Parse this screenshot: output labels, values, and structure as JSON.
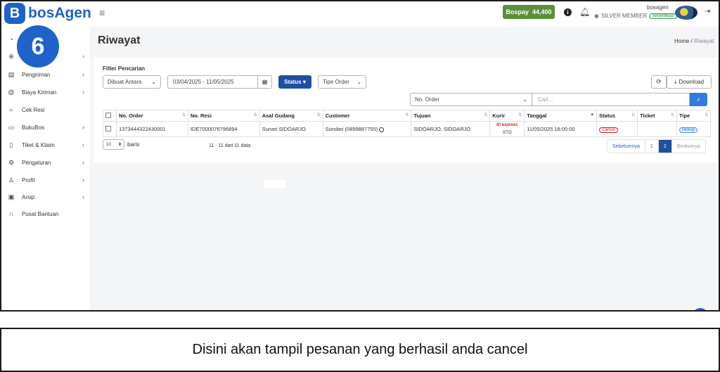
{
  "brand": {
    "logo_letter": "B",
    "name": "bosAgen",
    "accent": "#1e63c9"
  },
  "step_number": "6",
  "topbar": {
    "menu_icon": "hamburger-icon",
    "bospay_label": "Bospay",
    "bospay_amount": "44,400",
    "user_name": "bosagen",
    "member_level": "SILVER MEMBER",
    "verified_label": "Terverifikasi"
  },
  "sidebar": {
    "items": [
      {
        "label": "",
        "icon": "dashboard-icon",
        "has_chevron": false
      },
      {
        "label": "",
        "icon": "plus-circle-icon",
        "has_chevron": true
      },
      {
        "label": "Pengiriman",
        "icon": "document-icon",
        "has_chevron": true
      },
      {
        "label": "Biaya Kiriman",
        "icon": "at-icon",
        "has_chevron": true
      },
      {
        "label": "Cek Resi",
        "icon": "search-icon",
        "has_chevron": false
      },
      {
        "label": "BukuBos",
        "icon": "card-icon",
        "has_chevron": true
      },
      {
        "label": "Tiket & Klaim",
        "icon": "ticket-icon",
        "has_chevron": true
      },
      {
        "label": "Pengaturan",
        "icon": "gear-icon",
        "has_chevron": true
      },
      {
        "label": "Profil",
        "icon": "user-icon",
        "has_chevron": true
      },
      {
        "label": "Arsip",
        "icon": "archive-icon",
        "has_chevron": true
      },
      {
        "label": "Pusat Bantuan",
        "icon": "headset-icon",
        "has_chevron": false
      }
    ]
  },
  "page": {
    "title": "Riwayat",
    "breadcrumb_home": "Home",
    "breadcrumb_sep": "/",
    "breadcrumb_current": "Riwayat"
  },
  "filter": {
    "label": "Filter Pencarian",
    "date_type": "Dibuat Antara",
    "date_range": "03/04/2025 - 11/05/2025",
    "status_button": "Status",
    "order_type": "Tipe Order",
    "download_label": "Download",
    "search_field": "No. Order",
    "search_placeholder": "Cari..."
  },
  "table": {
    "columns": [
      "No. Order",
      "No. Resi",
      "Asal Gudang",
      "Customer",
      "Tujuan",
      "Kurir",
      "Tanggal",
      "Status",
      "Ticket",
      "Tipe"
    ],
    "rows": [
      {
        "order": "1373444322430001",
        "resi": "IDE700007679689​4",
        "gudang": "Sunari SIDOARJO",
        "customer": "Sundari (0899887755)",
        "tujuan": "SIDOARJO, SIDOARJO",
        "kurir_brand": "ID express",
        "kurir_service": "STD",
        "tanggal": "11/05/2025 18:00:00",
        "status": "Cancel",
        "ticket": "",
        "tipe": "Pickup"
      }
    ]
  },
  "footer": {
    "per_page": "10",
    "per_page_label": "baris",
    "info": "11 - 11 dari 11 data",
    "prev": "Sebelumnya",
    "pages": [
      "1",
      "2"
    ],
    "active_page": "2",
    "next": "Berikutnya"
  },
  "caption": "Disini akan tampil pesanan yang berhasil anda cancel"
}
